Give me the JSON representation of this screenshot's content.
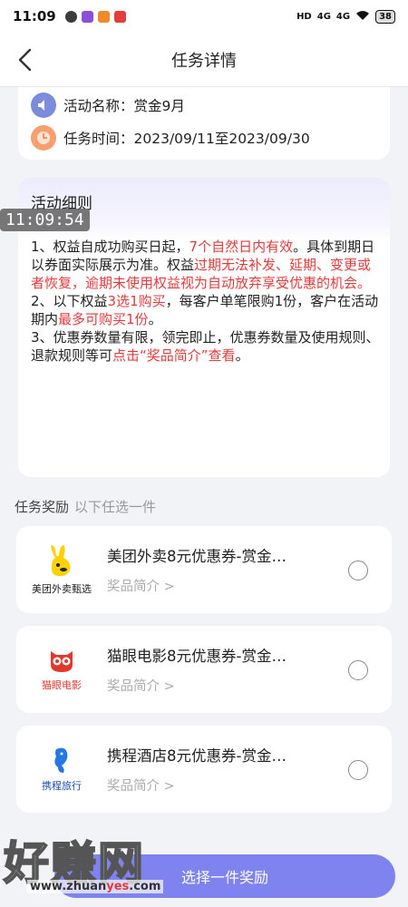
{
  "status_bar": {
    "time": "11:09",
    "network": "4G",
    "battery": "38"
  },
  "nav": {
    "title": "任务详情"
  },
  "info": {
    "activity_name": "活动名称：赏金9月",
    "task_time": "任务时间：2023/09/11至2023/09/30"
  },
  "detail": {
    "title": "活动细则",
    "p1_a": "1、权益自成功购买日起，",
    "p1_red1": "7个自然日内有效",
    "p1_b": "。具体到期日以券面实际展示为准。权益",
    "p1_red2": "过期无法补发、延期、变更或者恢复，逾期未使用权益视为自动放弃享受优惠的机会。",
    "p2_a": "2、以下权益",
    "p2_red1": "3选1购买",
    "p2_b": "，每客户单笔限购1份，客户在活动期内",
    "p2_red2": "最多可购买1份",
    "p2_c": "。",
    "p3_a": "3、优惠券数量有限，领完即止，优惠券数量及使用规则、退款规则等可",
    "p3_red": "点击“奖品简介”查看",
    "p3_b": "。"
  },
  "overlay_timestamp": "11:09:54",
  "rewards_section": {
    "label": "任务奖励",
    "sub": "以下任选一件"
  },
  "rewards": [
    {
      "name": "美团外卖8元优惠券-赏金…",
      "intro": "奖品简介 >",
      "logo_text": "美团外卖甄选"
    },
    {
      "name": "猫眼电影8元优惠券-赏金…",
      "intro": "奖品简介 >",
      "logo_text": "猫眼电影"
    },
    {
      "name": "携程酒店8元优惠券-赏金…",
      "intro": "奖品简介 >",
      "logo_text": "携程旅行"
    }
  ],
  "submit": {
    "label": "选择一件奖励"
  },
  "watermark": {
    "big": "好赚网",
    "url_a": "www.zhuan",
    "url_accent": "yes",
    "url_b": ".com"
  },
  "colors": {
    "accent": "#7f83f0",
    "red": "#e23b3b"
  }
}
